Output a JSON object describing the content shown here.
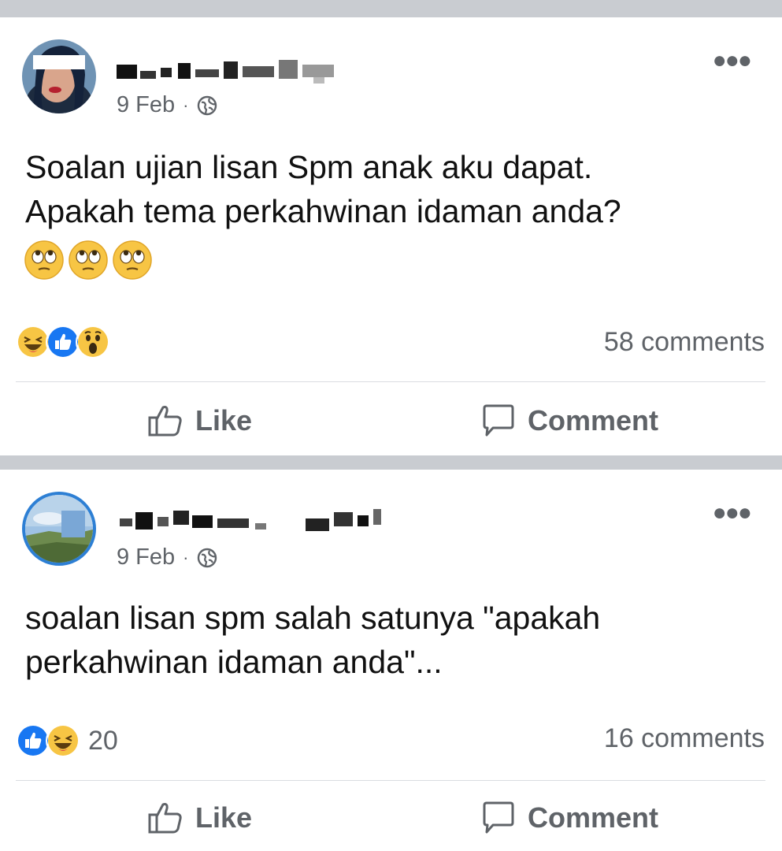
{
  "posts": [
    {
      "date": "9 Feb",
      "separator": "·",
      "text_lines": [
        "Soalan ujian lisan Spm anak aku dapat.",
        "Apakah tema perkahwinan idaman anda?"
      ],
      "emojis": [
        "face-with-rolling-eyes",
        "face-with-rolling-eyes",
        "face-with-rolling-eyes"
      ],
      "reactions": [
        "haha",
        "like",
        "wow"
      ],
      "reaction_count": "",
      "comments": "58 comments",
      "actions": {
        "like": "Like",
        "comment": "Comment"
      }
    },
    {
      "date": "9 Feb",
      "separator": "·",
      "text_lines": [
        "soalan lisan spm salah satunya \"apakah",
        "perkahwinan idaman anda\"..."
      ],
      "emojis": [],
      "reactions": [
        "like",
        "haha"
      ],
      "reaction_count": "20",
      "comments": "16 comments",
      "actions": {
        "like": "Like",
        "comment": "Comment"
      }
    }
  ],
  "colors": {
    "like_blue": "#1877f2",
    "emoji_yellow": "#f7c544",
    "divider": "#c9ccd1",
    "secondary_text": "#5f6368"
  }
}
